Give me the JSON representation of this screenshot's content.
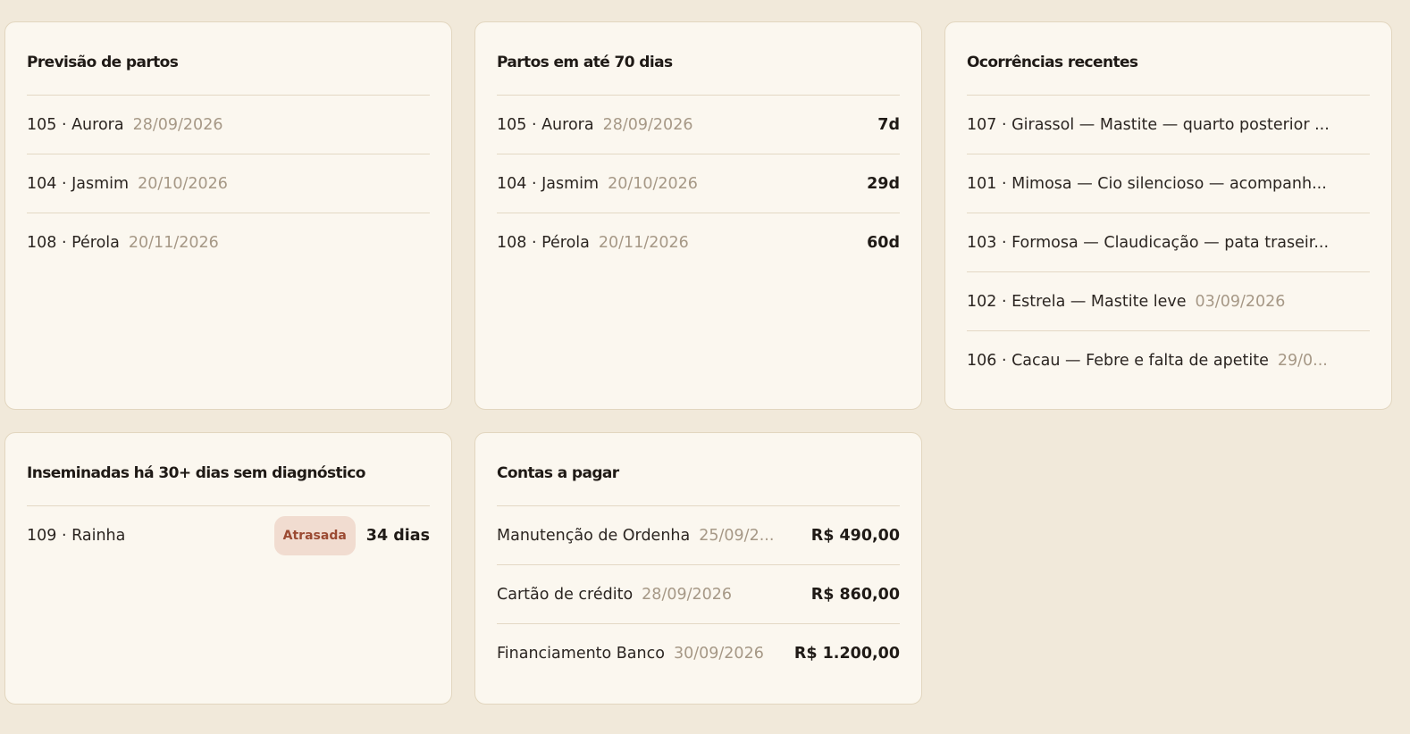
{
  "cards": {
    "previsao": {
      "title": "Previsão de partos",
      "rows": [
        {
          "label": "105 · Aurora",
          "date": "28/09/2026"
        },
        {
          "label": "104 · Jasmim",
          "date": "20/10/2026"
        },
        {
          "label": "108 · Pérola",
          "date": "20/11/2026"
        }
      ]
    },
    "partos70": {
      "title": "Partos em até 70 dias",
      "rows": [
        {
          "label": "105 · Aurora",
          "date": "28/09/2026",
          "value": "7d"
        },
        {
          "label": "104 · Jasmim",
          "date": "20/10/2026",
          "value": "29d"
        },
        {
          "label": "108 · Pérola",
          "date": "20/11/2026",
          "value": "60d"
        }
      ]
    },
    "ocorrencias": {
      "title": "Ocorrências recentes",
      "rows": [
        {
          "label": "107 · Girassol — Mastite — quarto posterior ...",
          "date": ""
        },
        {
          "label": "101 · Mimosa — Cio silencioso — acompanh...",
          "date": ""
        },
        {
          "label": "103 · Formosa — Claudicação — pata traseir...",
          "date": ""
        },
        {
          "label": "102 · Estrela — Mastite leve",
          "date": "03/09/2026"
        },
        {
          "label": "106 · Cacau — Febre e falta de apetite",
          "date": "29/0..."
        }
      ]
    },
    "inseminadas": {
      "title": "Inseminadas há 30+ dias sem diagnóstico",
      "rows": [
        {
          "label": "109 · Rainha",
          "badge": "Atrasada",
          "value": "34 dias"
        }
      ]
    },
    "contas": {
      "title": "Contas a pagar",
      "rows": [
        {
          "label": "Manutenção de Ordenha",
          "date": "25/09/2...",
          "value": "R$ 490,00"
        },
        {
          "label": "Cartão de crédito",
          "date": "28/09/2026",
          "value": "R$ 860,00"
        },
        {
          "label": "Financiamento Banco",
          "date": "30/09/2026",
          "value": "R$ 1.200,00"
        }
      ]
    }
  },
  "colors": {
    "background": "#f1e9da",
    "card": "#fbf7ef",
    "border": "#e2d6bf",
    "muted_text": "#a69886",
    "badge_bg": "#f1dcd0",
    "badge_text": "#9b4a32"
  }
}
